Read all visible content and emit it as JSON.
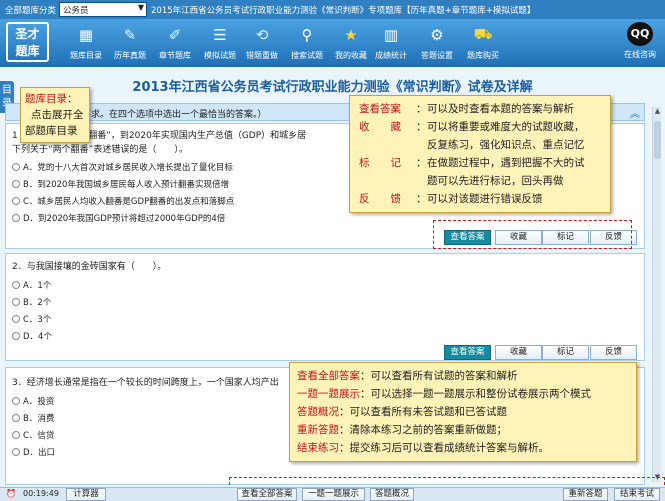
{
  "topbar": {
    "category_label": "全部题库分类",
    "category_value": "公务员",
    "title": "2015年江西省公务员考试行政职业能力测验《常识判断》专项题库【历年真题+章节题库+模拟试题】"
  },
  "logo": {
    "line1": "圣才",
    "line2": "题库"
  },
  "toolbar": [
    {
      "label": "题库目录",
      "icon": "book-icon",
      "glyph": "▦",
      "color": "#ffffff"
    },
    {
      "label": "历年真题",
      "icon": "paper-icon",
      "glyph": "✎",
      "color": "#e8f2fb"
    },
    {
      "label": "章节题库",
      "icon": "notebook-icon",
      "glyph": "✐",
      "color": "#e8f2fb"
    },
    {
      "label": "模拟试题",
      "icon": "exam-icon",
      "glyph": "☰",
      "color": "#ffffff"
    },
    {
      "label": "错题重做",
      "icon": "undo-icon",
      "glyph": "⟲",
      "color": "#dcebf8"
    },
    {
      "label": "搜索试题",
      "icon": "search-icon",
      "glyph": "⚲",
      "color": "#ffffff"
    },
    {
      "label": "我的收藏",
      "icon": "star-icon",
      "glyph": "★",
      "color": "#ffd43b"
    },
    {
      "label": "成绩统计",
      "icon": "chart-icon",
      "glyph": "▥",
      "color": "#ffffff"
    },
    {
      "label": "答题设置",
      "icon": "gear-icon",
      "glyph": "⚙",
      "color": "#ffffff"
    },
    {
      "label": "题库购买",
      "icon": "cart-icon",
      "glyph": "⛟",
      "color": "#fdd835"
    }
  ],
  "online": {
    "label": "在线咨询",
    "icon": "qq-icon",
    "glyph": "QQ"
  },
  "paper_title": "2013年江西省公务员考试行政职业能力测验《常识判断》试卷及详解",
  "side_tab": {
    "text": "目录"
  },
  "instruction": {
    "text": "题目要求。在四个选项中选出一个最恰当的答案。）"
  },
  "questions": [
    {
      "stem_line1": "1 ………提出“两个翻番”，到2020年实现国内生产总值（GDP）和城乡居",
      "stem_line2": "下列关于“两个翻番”表述错误的是（　　）。",
      "options": [
        "A．党的十八大首次对城乡居民收入增长提出了量化目标",
        "B．到2020年我国城乡居民每人收入预计翻番实现倍增",
        "C．城乡居民人均收入翻番是GDP翻番的出发点和落脚点",
        "D．到2020年我国GDP预计将超过2000年GDP的4倍"
      ]
    },
    {
      "stem_line1": "2．与我国接壤的金砖国家有（　　）。",
      "options": [
        "A．1个",
        "B．2个",
        "C．3个",
        "D．4个"
      ]
    },
    {
      "stem_line1": "3．经济增长通常是指在一个较长的时间跨度上，一个国家人均产出",
      "options": [
        "A．投资",
        "B．消费",
        "C．信贷",
        "D．出口"
      ]
    }
  ],
  "question_buttons": {
    "answer": "查看答案",
    "favorite": "收藏",
    "mark": "标记",
    "feedback": "反馈"
  },
  "callout_catalog": {
    "title": "题库目录：",
    "line2": "点击展开全",
    "line3": "部题库目录"
  },
  "callout_answer": [
    {
      "key": "查看答案",
      "sep": "：",
      "desc": "可以及时查看本题的答案与解析"
    },
    {
      "key": "收　　藏",
      "sep": "：",
      "desc": "可以将重要或难度大的试题收藏，"
    },
    {
      "key": "",
      "sep": "",
      "desc": "反复练习，强化知识点、重点记忆"
    },
    {
      "key": "标　　记",
      "sep": "：",
      "desc": "在做题过程中，遇到把握不大的试"
    },
    {
      "key": "",
      "sep": "",
      "desc": "题可以先进行标记，回头再做"
    },
    {
      "key": "反　　馈",
      "sep": "：",
      "desc": "可以对该题进行错误反馈"
    }
  ],
  "callout_bottom": [
    {
      "key": "查看全部答案",
      "desc": "：可以查看所有试题的答案和解析"
    },
    {
      "key": "一题一题展示",
      "desc": "：可以选择一题一题展示和整份试卷展示两个模式"
    },
    {
      "key": "答题概况",
      "desc": "：可以查看所有未答试题和已答试题"
    },
    {
      "key": "重新答题",
      "desc": "：清除本练习之前的答案重新做题；"
    },
    {
      "key": "结束练习",
      "desc": "：提交练习后可以查看成绩统计答案与解析。"
    }
  ],
  "bottombar": {
    "time": "00:19:49",
    "calculator": "计算器",
    "show_all": "查看全部答案",
    "one_by_one": "一题一题展示",
    "overview": "答题概况",
    "restart": "重新答题",
    "finish": "结束考试"
  },
  "colors": {
    "accent": "#2f7fc1",
    "primary_button": "#148ba0",
    "callout_bg": "#fff3b8",
    "highlight_red": "#c4121c"
  }
}
